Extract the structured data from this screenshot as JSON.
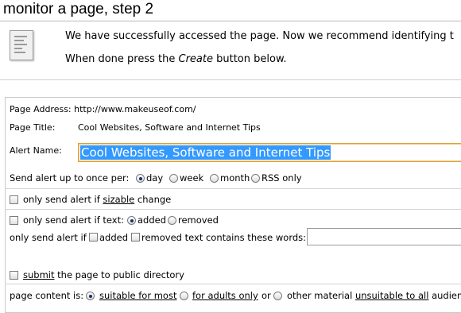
{
  "header": {
    "title": "monitor a page, step 2"
  },
  "intro": {
    "line1": "We have successfully accessed the page. Now we recommend identifying t",
    "line2_prefix": "When done press the ",
    "line2_emph": "Create",
    "line2_suffix": " button below."
  },
  "form": {
    "page_address_label": "Page Address:",
    "page_address_value": "http://www.makeuseof.com/",
    "page_title_label": "Page Title:",
    "page_title_value": "Cool Websites, Software and Internet Tips",
    "alert_name_label": "Alert Name:",
    "alert_name_value": "Cool Websites, Software and Internet Tips",
    "frequency_label": "Send alert up to once per:",
    "frequency_options": [
      "day",
      "week",
      "month",
      "RSS only"
    ],
    "frequency_selected": "day",
    "sizable_prefix": "only send alert if ",
    "sizable_u": "sizable",
    "sizable_suffix": " change",
    "text_label": "only send alert if text:",
    "text_options": [
      "added",
      "removed"
    ],
    "text_selected": "added",
    "words_prefix": "only send alert if",
    "words_added": "added",
    "words_removed": "removed text contains these words:",
    "words_value": "",
    "submit_u": "submit",
    "submit_suffix": " the page to public directory",
    "content_label": "page content is:",
    "content_option1": "suitable for most",
    "content_option2": "for adults only",
    "content_or": "or",
    "content_option3_prefix": "other material ",
    "content_option3_u": "unsuitable to all",
    "content_option3_suffix": " audien",
    "content_selected": "suitable for most"
  }
}
